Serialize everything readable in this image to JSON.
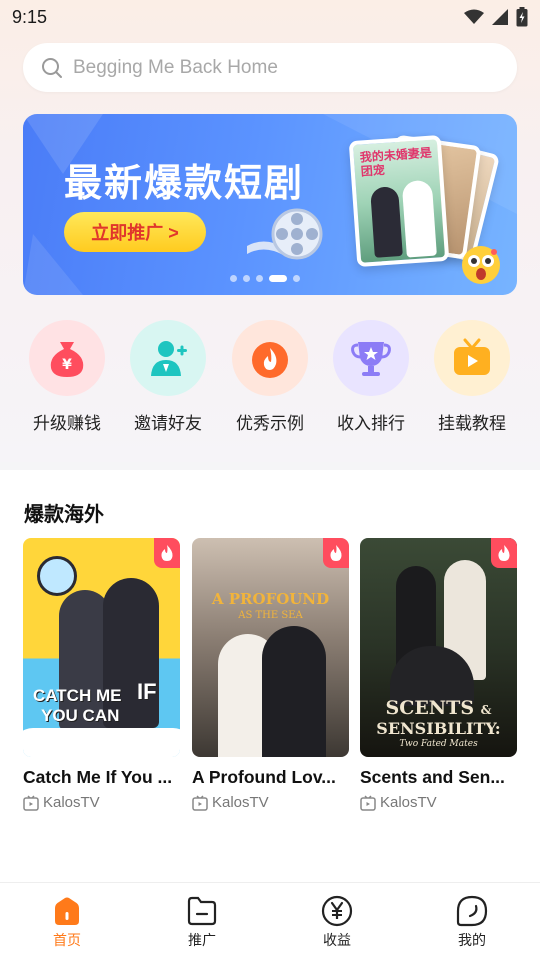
{
  "status_bar": {
    "time": "9:15"
  },
  "search": {
    "placeholder": "Begging Me Back Home"
  },
  "banner": {
    "title": "最新爆款短剧",
    "button_label": "立即推广 >",
    "poster_caption": "我的未婚妻是团宠",
    "slide_count": 5,
    "active_slide": 4
  },
  "quick_actions": [
    {
      "label": "升级赚钱",
      "icon": "money-bag-icon",
      "color": "#ff4d5e"
    },
    {
      "label": "邀请好友",
      "icon": "add-user-icon",
      "color": "#1ec5c0"
    },
    {
      "label": "优秀示例",
      "icon": "flame-icon",
      "color": "#ff7a3a"
    },
    {
      "label": "收入排行",
      "icon": "trophy-icon",
      "color": "#8c7cf6"
    },
    {
      "label": "挂载教程",
      "icon": "tv-icon",
      "color": "#ffb020"
    }
  ],
  "section": {
    "title": "爆款海外"
  },
  "dramas": [
    {
      "title": "Catch Me If You ...",
      "source": "KalosTV",
      "poster_text": "CATCH ME IF YOU CAN",
      "poster_line1": "CATCH ME",
      "poster_line2": "YOU CAN",
      "poster_mark": "IF"
    },
    {
      "title": "A Profound Lov...",
      "source": "KalosTV",
      "poster_text": "A PROFOUND LOVE AS THE SEA",
      "poster_line1": "A PROFOUND",
      "poster_line2": "AS THE SEA"
    },
    {
      "title": "Scents and Sen...",
      "source": "KalosTV",
      "poster_text": "SCENTS & SENSIBILITY: Two Fated Mates",
      "poster_line1": "SCENTS",
      "poster_amp": "&",
      "poster_line2": "SENSIBILITY:",
      "poster_line3": "Two Fated Mates"
    }
  ],
  "tabbar": {
    "items": [
      {
        "label": "首页",
        "icon": "home-icon",
        "active": true
      },
      {
        "label": "推广",
        "icon": "folder-icon",
        "active": false
      },
      {
        "label": "收益",
        "icon": "yen-icon",
        "active": false
      },
      {
        "label": "我的",
        "icon": "profile-icon",
        "active": false
      }
    ],
    "active_color": "#ff7a1a"
  }
}
